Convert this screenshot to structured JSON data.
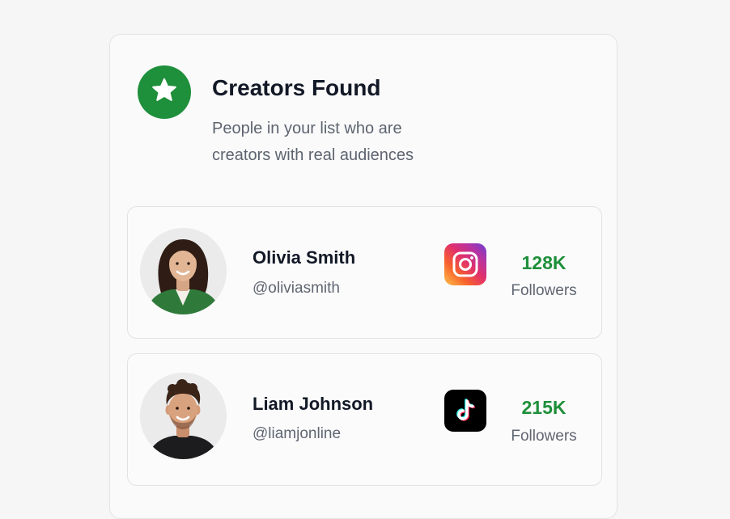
{
  "header": {
    "title": "Creators Found",
    "subtitle_line1": "People in your list who are",
    "subtitle_line2": "creators with real audiences",
    "icon": "star-icon",
    "accent_color": "#1e8f3a"
  },
  "creators": [
    {
      "name": "Olivia Smith",
      "handle": "@oliviasmith",
      "platform": "instagram-icon",
      "followers_count": "128K",
      "followers_label": "Followers"
    },
    {
      "name": "Liam Johnson",
      "handle": "@liamjonline",
      "platform": "tiktok-icon",
      "followers_count": "215K",
      "followers_label": "Followers"
    }
  ]
}
